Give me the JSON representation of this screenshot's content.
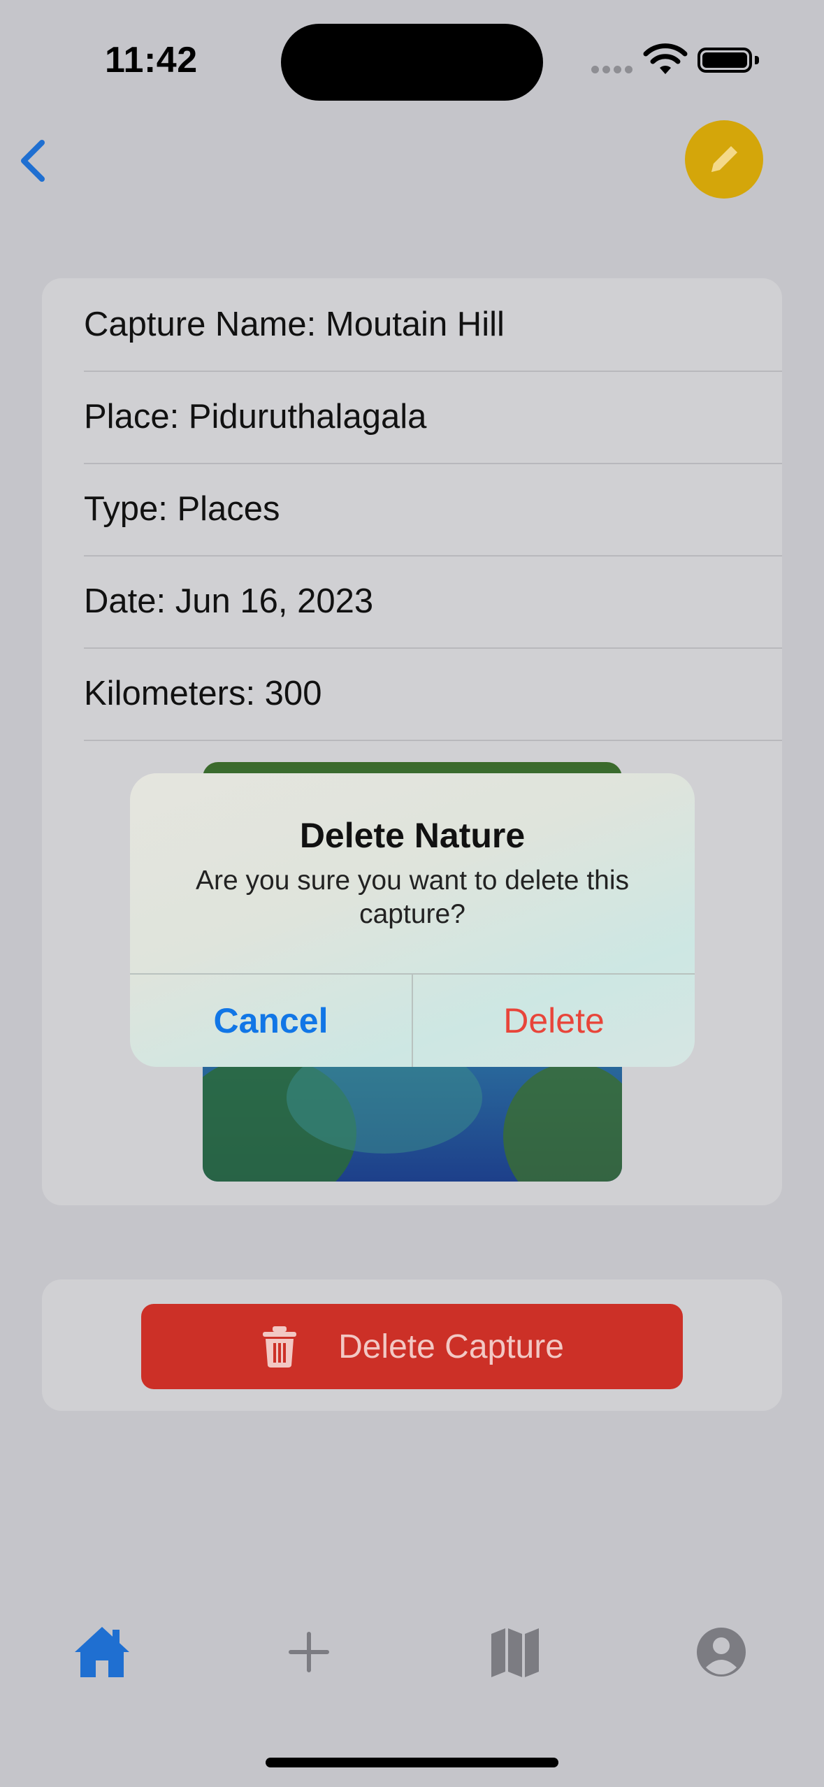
{
  "status_bar": {
    "time": "11:42"
  },
  "details": {
    "capture_name": "Capture Name: Moutain Hill",
    "place": "Place: Piduruthalagala",
    "type": "Type: Places",
    "date": "Date: Jun 16, 2023",
    "kilometers": "Kilometers: 300"
  },
  "actions": {
    "delete_capture_label": "Delete Capture"
  },
  "alert": {
    "title": "Delete Nature",
    "message": "Are you sure you want to delete this capture?",
    "cancel_label": "Cancel",
    "delete_label": "Delete"
  },
  "tab_bar": {
    "items": [
      {
        "icon": "home-icon",
        "selected": true
      },
      {
        "icon": "plus-icon",
        "selected": false
      },
      {
        "icon": "map-icon",
        "selected": false
      },
      {
        "icon": "profile-icon",
        "selected": false
      }
    ]
  },
  "colors": {
    "accent": "#1176e6",
    "edit_button": "#d4a60a",
    "destructive": "#cc3027"
  }
}
